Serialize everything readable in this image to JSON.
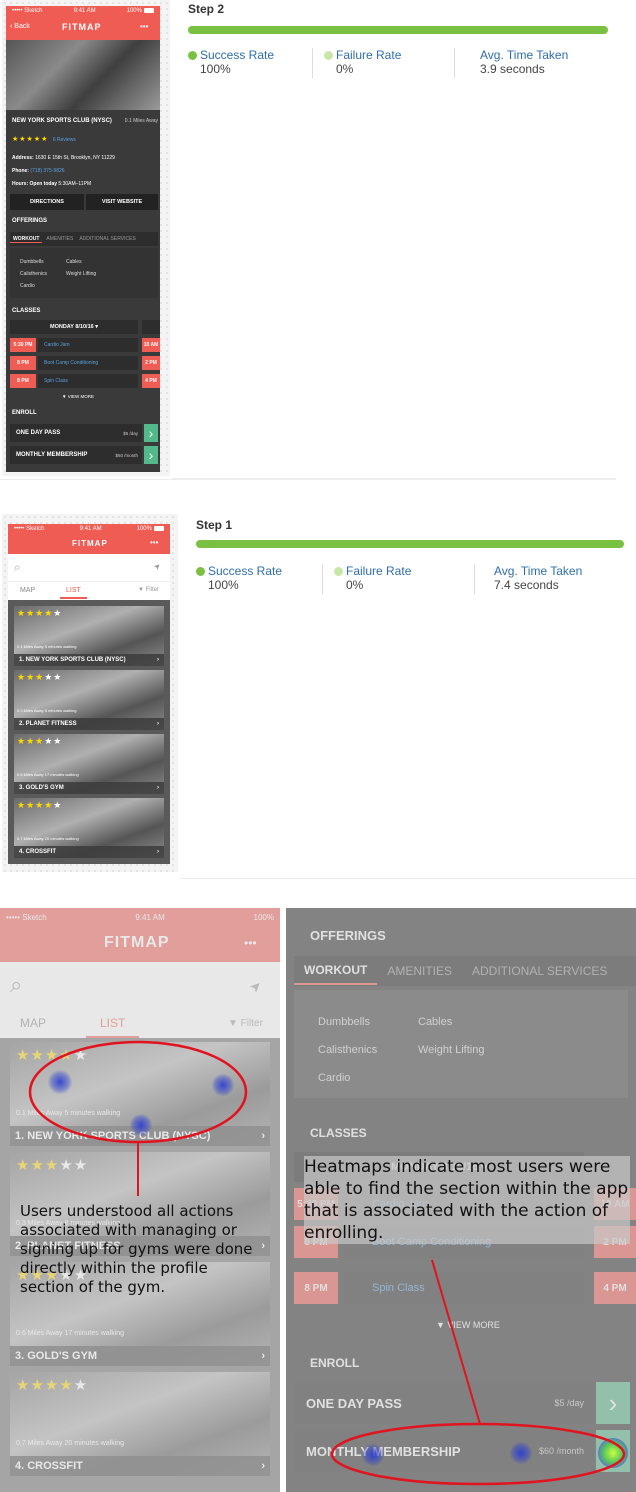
{
  "colors": {
    "brand_red": "#ef5c53",
    "success_green": "#7ac143",
    "link_blue": "#2f6ea8",
    "enroll_green": "#53b98b",
    "heat_blue": "#2838d2"
  },
  "status_bar": {
    "carrier": "••••• Sketch",
    "time": "9:41 AM",
    "battery": "100%"
  },
  "step2": {
    "title": "Step 2",
    "progress": 1.0,
    "metrics": [
      {
        "label": "Success Rate",
        "value": "100%",
        "dot_color": "#7ac143"
      },
      {
        "label": "Failure Rate",
        "value": "0%",
        "dot_color": "#c8e6a8"
      },
      {
        "label": "Avg. Time Taken",
        "value": "3.9 seconds"
      }
    ]
  },
  "step1": {
    "title": "Step 1",
    "progress": 1.0,
    "metrics": [
      {
        "label": "Success Rate",
        "value": "100%",
        "dot_color": "#7ac143"
      },
      {
        "label": "Failure Rate",
        "value": "0%",
        "dot_color": "#c8e6a8"
      },
      {
        "label": "Avg. Time Taken",
        "value": "7.4 seconds"
      }
    ]
  },
  "detail_app": {
    "back_label": "Back",
    "app_title": "FITMAP",
    "more": "•••",
    "gym_name": "NEW YORK SPORTS CLUB (NYSC)",
    "distance": "0.1 Miles Away",
    "stars": "★★★★★",
    "reviews": "6 Reviews",
    "address_label": "Address:",
    "address": "1630 E 15th St, Brooklyn, NY 11229",
    "phone_label": "Phone:",
    "phone": "(718) 375-9826",
    "hours_label": "Hours: Open today",
    "hours": "5:30AM–11PM",
    "directions": "DIRECTIONS",
    "visit_website": "VISIT WEBSITE",
    "offerings_title": "OFFERINGS",
    "tabs": [
      "WORKOUT",
      "AMENITIES",
      "ADDITIONAL SERVICES"
    ],
    "offerings_col1": [
      "Dumbbells",
      "Calisthenics",
      "Cardio"
    ],
    "offerings_col2": [
      "Cables",
      "Weight Lifting"
    ],
    "classes_title": "CLASSES",
    "classes_date": "MONDAY 8/10/16",
    "classes": [
      {
        "time": "5:30 PM",
        "name": "Cardio Jam",
        "right_time": "10 AM"
      },
      {
        "time": "8 PM",
        "name": "Boot Camp Conditioning",
        "right_time": "2 PM"
      },
      {
        "time": "8 PM",
        "name": "Spin Class",
        "right_time": "4 PM"
      }
    ],
    "view_more": "▼ VIEW MORE",
    "enroll_title": "ENROLL",
    "enroll": [
      {
        "name": "ONE DAY PASS",
        "price": "$5 /day"
      },
      {
        "name": "MONTHLY MEMBERSHIP",
        "price": "$60 /month"
      }
    ],
    "arrow": "›"
  },
  "list_app": {
    "app_title": "FITMAP",
    "more": "•••",
    "search_icon": "⌕",
    "location_icon": "➤",
    "tab_map": "MAP",
    "tab_list": "LIST",
    "filter": "▼ Filter",
    "gyms": [
      {
        "name": "1. NEW YORK SPORTS CLUB (NYSC)",
        "info": "0.1 Miles Away  5 minutes walking",
        "gold_stars": "★★★★",
        "white_stars": "★"
      },
      {
        "name": "2. PLANET FITNESS",
        "info": "0.3 Miles Away  8 minutes walking",
        "gold_stars": "★★★",
        "white_stars": "★★"
      },
      {
        "name": "3. GOLD'S GYM",
        "info": "0.6 Miles Away  17 minutes walking",
        "gold_stars": "★★★",
        "white_stars": "★★"
      },
      {
        "name": "4. CROSSFIT",
        "info": "0.7 Miles Away  20 minutes walking",
        "gold_stars": "★★★★",
        "white_stars": "★"
      }
    ],
    "chevron": "›"
  },
  "heatmap_left": {
    "annotation": "Users understood all actions associated with managing or signing up for gyms were done directly within the profile section of the gym."
  },
  "heatmap_right": {
    "annotation": "Heatmaps indicate most users were able to find the section within the app that is associated with the action of enrolling."
  }
}
